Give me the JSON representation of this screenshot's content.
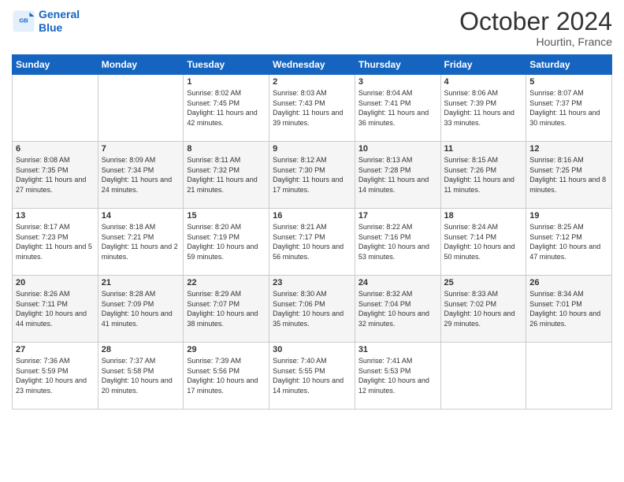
{
  "logo": {
    "line1": "General",
    "line2": "Blue"
  },
  "title": "October 2024",
  "location": "Hourtin, France",
  "days_of_week": [
    "Sunday",
    "Monday",
    "Tuesday",
    "Wednesday",
    "Thursday",
    "Friday",
    "Saturday"
  ],
  "weeks": [
    [
      {
        "day": "",
        "sunrise": "",
        "sunset": "",
        "daylight": ""
      },
      {
        "day": "",
        "sunrise": "",
        "sunset": "",
        "daylight": ""
      },
      {
        "day": "1",
        "sunrise": "Sunrise: 8:02 AM",
        "sunset": "Sunset: 7:45 PM",
        "daylight": "Daylight: 11 hours and 42 minutes."
      },
      {
        "day": "2",
        "sunrise": "Sunrise: 8:03 AM",
        "sunset": "Sunset: 7:43 PM",
        "daylight": "Daylight: 11 hours and 39 minutes."
      },
      {
        "day": "3",
        "sunrise": "Sunrise: 8:04 AM",
        "sunset": "Sunset: 7:41 PM",
        "daylight": "Daylight: 11 hours and 36 minutes."
      },
      {
        "day": "4",
        "sunrise": "Sunrise: 8:06 AM",
        "sunset": "Sunset: 7:39 PM",
        "daylight": "Daylight: 11 hours and 33 minutes."
      },
      {
        "day": "5",
        "sunrise": "Sunrise: 8:07 AM",
        "sunset": "Sunset: 7:37 PM",
        "daylight": "Daylight: 11 hours and 30 minutes."
      }
    ],
    [
      {
        "day": "6",
        "sunrise": "Sunrise: 8:08 AM",
        "sunset": "Sunset: 7:35 PM",
        "daylight": "Daylight: 11 hours and 27 minutes."
      },
      {
        "day": "7",
        "sunrise": "Sunrise: 8:09 AM",
        "sunset": "Sunset: 7:34 PM",
        "daylight": "Daylight: 11 hours and 24 minutes."
      },
      {
        "day": "8",
        "sunrise": "Sunrise: 8:11 AM",
        "sunset": "Sunset: 7:32 PM",
        "daylight": "Daylight: 11 hours and 21 minutes."
      },
      {
        "day": "9",
        "sunrise": "Sunrise: 8:12 AM",
        "sunset": "Sunset: 7:30 PM",
        "daylight": "Daylight: 11 hours and 17 minutes."
      },
      {
        "day": "10",
        "sunrise": "Sunrise: 8:13 AM",
        "sunset": "Sunset: 7:28 PM",
        "daylight": "Daylight: 11 hours and 14 minutes."
      },
      {
        "day": "11",
        "sunrise": "Sunrise: 8:15 AM",
        "sunset": "Sunset: 7:26 PM",
        "daylight": "Daylight: 11 hours and 11 minutes."
      },
      {
        "day": "12",
        "sunrise": "Sunrise: 8:16 AM",
        "sunset": "Sunset: 7:25 PM",
        "daylight": "Daylight: 11 hours and 8 minutes."
      }
    ],
    [
      {
        "day": "13",
        "sunrise": "Sunrise: 8:17 AM",
        "sunset": "Sunset: 7:23 PM",
        "daylight": "Daylight: 11 hours and 5 minutes."
      },
      {
        "day": "14",
        "sunrise": "Sunrise: 8:18 AM",
        "sunset": "Sunset: 7:21 PM",
        "daylight": "Daylight: 11 hours and 2 minutes."
      },
      {
        "day": "15",
        "sunrise": "Sunrise: 8:20 AM",
        "sunset": "Sunset: 7:19 PM",
        "daylight": "Daylight: 10 hours and 59 minutes."
      },
      {
        "day": "16",
        "sunrise": "Sunrise: 8:21 AM",
        "sunset": "Sunset: 7:17 PM",
        "daylight": "Daylight: 10 hours and 56 minutes."
      },
      {
        "day": "17",
        "sunrise": "Sunrise: 8:22 AM",
        "sunset": "Sunset: 7:16 PM",
        "daylight": "Daylight: 10 hours and 53 minutes."
      },
      {
        "day": "18",
        "sunrise": "Sunrise: 8:24 AM",
        "sunset": "Sunset: 7:14 PM",
        "daylight": "Daylight: 10 hours and 50 minutes."
      },
      {
        "day": "19",
        "sunrise": "Sunrise: 8:25 AM",
        "sunset": "Sunset: 7:12 PM",
        "daylight": "Daylight: 10 hours and 47 minutes."
      }
    ],
    [
      {
        "day": "20",
        "sunrise": "Sunrise: 8:26 AM",
        "sunset": "Sunset: 7:11 PM",
        "daylight": "Daylight: 10 hours and 44 minutes."
      },
      {
        "day": "21",
        "sunrise": "Sunrise: 8:28 AM",
        "sunset": "Sunset: 7:09 PM",
        "daylight": "Daylight: 10 hours and 41 minutes."
      },
      {
        "day": "22",
        "sunrise": "Sunrise: 8:29 AM",
        "sunset": "Sunset: 7:07 PM",
        "daylight": "Daylight: 10 hours and 38 minutes."
      },
      {
        "day": "23",
        "sunrise": "Sunrise: 8:30 AM",
        "sunset": "Sunset: 7:06 PM",
        "daylight": "Daylight: 10 hours and 35 minutes."
      },
      {
        "day": "24",
        "sunrise": "Sunrise: 8:32 AM",
        "sunset": "Sunset: 7:04 PM",
        "daylight": "Daylight: 10 hours and 32 minutes."
      },
      {
        "day": "25",
        "sunrise": "Sunrise: 8:33 AM",
        "sunset": "Sunset: 7:02 PM",
        "daylight": "Daylight: 10 hours and 29 minutes."
      },
      {
        "day": "26",
        "sunrise": "Sunrise: 8:34 AM",
        "sunset": "Sunset: 7:01 PM",
        "daylight": "Daylight: 10 hours and 26 minutes."
      }
    ],
    [
      {
        "day": "27",
        "sunrise": "Sunrise: 7:36 AM",
        "sunset": "Sunset: 5:59 PM",
        "daylight": "Daylight: 10 hours and 23 minutes."
      },
      {
        "day": "28",
        "sunrise": "Sunrise: 7:37 AM",
        "sunset": "Sunset: 5:58 PM",
        "daylight": "Daylight: 10 hours and 20 minutes."
      },
      {
        "day": "29",
        "sunrise": "Sunrise: 7:39 AM",
        "sunset": "Sunset: 5:56 PM",
        "daylight": "Daylight: 10 hours and 17 minutes."
      },
      {
        "day": "30",
        "sunrise": "Sunrise: 7:40 AM",
        "sunset": "Sunset: 5:55 PM",
        "daylight": "Daylight: 10 hours and 14 minutes."
      },
      {
        "day": "31",
        "sunrise": "Sunrise: 7:41 AM",
        "sunset": "Sunset: 5:53 PM",
        "daylight": "Daylight: 10 hours and 12 minutes."
      },
      {
        "day": "",
        "sunrise": "",
        "sunset": "",
        "daylight": ""
      },
      {
        "day": "",
        "sunrise": "",
        "sunset": "",
        "daylight": ""
      }
    ]
  ]
}
